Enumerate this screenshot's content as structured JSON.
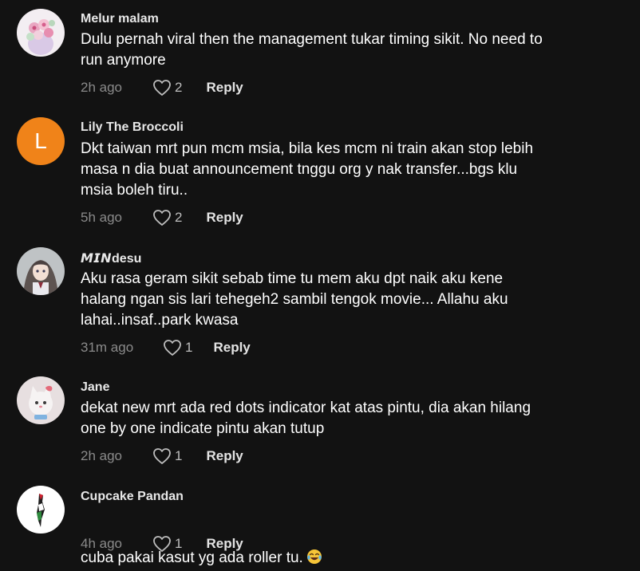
{
  "comments": [
    {
      "author": "Melur malam",
      "text": "Dulu pernah viral then the management tukar timing sikit. No need to\nrun anymore",
      "time": "2h ago",
      "likes": "2",
      "reply_label": "Reply",
      "avatar_icon": "flower-bouquet-avatar"
    },
    {
      "author": "Lily The Broccoli",
      "avatar_letter": "L",
      "avatar_color": "#f08319",
      "text": "Dkt taiwan mrt pun mcm msia, bila kes mcm ni train akan stop lebih\nmasa n dia buat announcement tnggu org y nak transfer...bgs klu\nmsia boleh tiru..",
      "time": "5h ago",
      "likes": "2",
      "reply_label": "Reply"
    },
    {
      "author_bold": "𝙈𝙄𝙉",
      "author_rest": "desu",
      "text": "Aku rasa geram sikit sebab time tu mem aku dpt naik aku kene\nhalang ngan sis lari tehegeh2 sambil tengok movie... Allahu aku\nlahai..insaf..park kwasa",
      "time": "31m ago",
      "likes": "1",
      "reply_label": "Reply",
      "avatar_icon": "anime-girl-avatar"
    },
    {
      "author": "Jane",
      "text": "dekat new mrt ada red dots indicator kat atas pintu, dia akan hilang\none by one indicate pintu akan tutup",
      "time": "2h ago",
      "likes": "1",
      "reply_label": "Reply",
      "avatar_icon": "cartoon-cat-avatar"
    },
    {
      "author": "Cupcake Pandan",
      "text": "cuba pakai kasut yg ada roller tu.",
      "emoji": "laughing-tears-emoji",
      "time": "4h ago",
      "likes": "1",
      "reply_label": "Reply",
      "avatar_icon": "palestine-map-avatar"
    }
  ],
  "colors": {
    "background": "#121212",
    "text": "#ffffff",
    "muted": "#8a8a8a",
    "reply": "#e4e4e4"
  }
}
